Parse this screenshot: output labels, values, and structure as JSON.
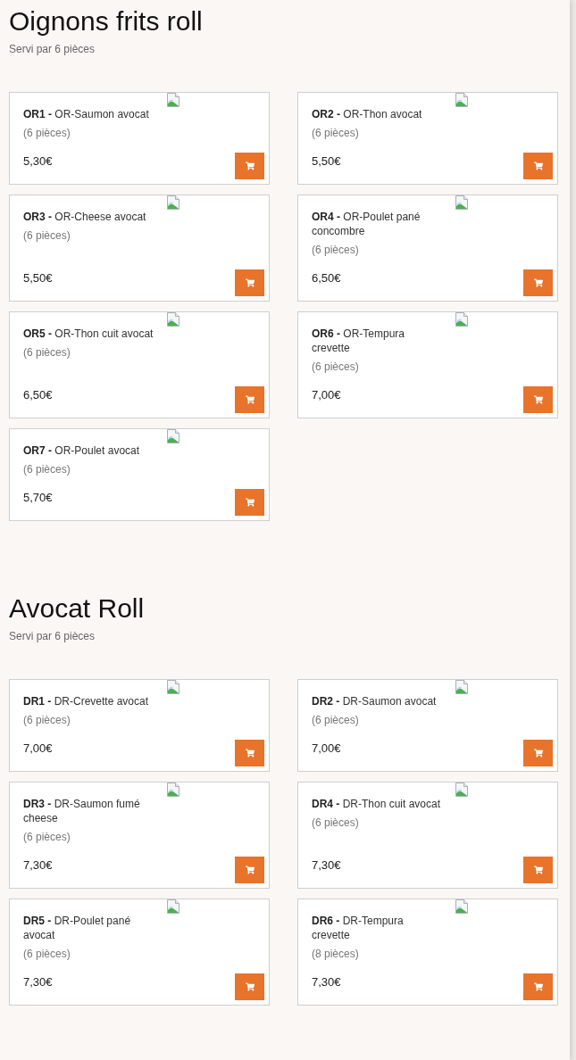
{
  "sections": [
    {
      "title": "Oignons frits roll",
      "subtitle": "Servi par 6 pièces",
      "items": [
        {
          "name": "**OR1 -** OR-Saumon avocat",
          "pieces": "(6 pièces)",
          "price": "5,30€"
        },
        {
          "name": "**OR2 -** OR-Thon avocat",
          "pieces": "(6 pièces)",
          "price": "5,50€"
        },
        {
          "name": "**OR3 -** OR-Cheese avocat",
          "pieces": "(6 pièces)",
          "price": "5,50€"
        },
        {
          "name": "**OR4 -** OR-Poulet pané concombre",
          "pieces": "(6 pièces)",
          "price": "6,50€"
        },
        {
          "name": "**OR5 -** OR-Thon cuit avocat",
          "pieces": "(6 pièces)",
          "price": "6,50€"
        },
        {
          "name": "**OR6 -** OR-Tempura crevette",
          "pieces": "(6 pièces)",
          "price": "7,00€"
        },
        {
          "name": "**OR7 -** OR-Poulet avocat",
          "pieces": "(6 pièces)",
          "price": "5,70€"
        }
      ]
    },
    {
      "title": "Avocat Roll",
      "subtitle": "Servi par 6 pièces",
      "items": [
        {
          "name": "**DR1 -** DR-Crevette avocat",
          "pieces": "(6 pièces)",
          "price": "7,00€"
        },
        {
          "name": "**DR2 -** DR-Saumon avocat",
          "pieces": "(6 pièces)",
          "price": "7,00€"
        },
        {
          "name": "**DR3 -** DR-Saumon fumé cheese",
          "pieces": "(6 pièces)",
          "price": "7,30€"
        },
        {
          "name": "**DR4 -** DR-Thon cuit avocat",
          "pieces": "(6 pièces)",
          "price": "7,30€"
        },
        {
          "name": "**DR5 -** DR-Poulet pané avocat",
          "pieces": "(6 pièces)",
          "price": "7,30€"
        },
        {
          "name": "**DR6 -** DR-Tempura crevette",
          "pieces": "(8 pièces)",
          "price": "7,30€"
        }
      ]
    }
  ]
}
